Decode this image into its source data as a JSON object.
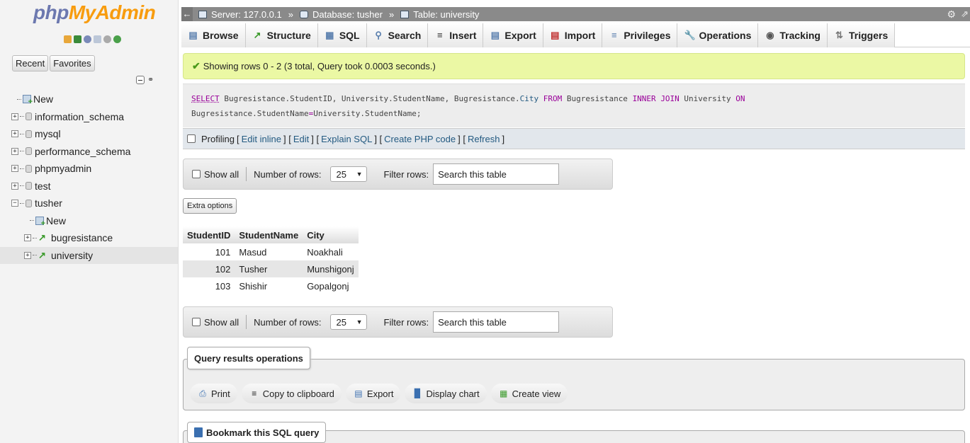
{
  "sidebar": {
    "logo_part1": "php",
    "logo_part2": "MyAdmin",
    "tabs": [
      "Recent",
      "Favorites"
    ],
    "tree": [
      {
        "label": "New",
        "type": "new",
        "level": 0
      },
      {
        "label": "information_schema",
        "type": "db",
        "level": 0
      },
      {
        "label": "mysql",
        "type": "db",
        "level": 0
      },
      {
        "label": "performance_schema",
        "type": "db",
        "level": 0
      },
      {
        "label": "phpmyadmin",
        "type": "db",
        "level": 0
      },
      {
        "label": "test",
        "type": "db",
        "level": 0
      },
      {
        "label": "tusher",
        "type": "db-open",
        "level": 0
      },
      {
        "label": "New",
        "type": "new",
        "level": 1
      },
      {
        "label": "bugresistance",
        "type": "table",
        "level": 1
      },
      {
        "label": "university",
        "type": "table",
        "level": 1
      }
    ]
  },
  "breadcrumb": {
    "server": "Server: 127.0.0.1",
    "database": "Database: tusher",
    "table": "Table: university"
  },
  "tabs": [
    "Browse",
    "Structure",
    "SQL",
    "Search",
    "Insert",
    "Export",
    "Import",
    "Privileges",
    "Operations",
    "Tracking",
    "Triggers"
  ],
  "success_message": "Showing rows 0 - 2 (3 total, Query took 0.0003 seconds.)",
  "sql": {
    "line1": {
      "select": "SELECT",
      "p1": " Bugresistance.StudentID, University.StudentName, Bugresistance.",
      "city": "City",
      "from": "FROM",
      "p2": " Bugresistance ",
      "inner": "INNER",
      "join": "JOIN",
      "p3": " University ",
      "on": "ON"
    },
    "line2": {
      "p1": "Bugresistance.StudentName",
      "eq": "=",
      "p2": "University.StudentName;"
    }
  },
  "profiling": {
    "label": "Profiling",
    "links": [
      "Edit inline",
      "Edit",
      "Explain SQL",
      "Create PHP code",
      "Refresh"
    ]
  },
  "navbar": {
    "show_all": "Show all",
    "number_of_rows": "Number of rows:",
    "rows_value": "25",
    "filter_rows": "Filter rows:",
    "search_placeholder": "Search this table"
  },
  "extra_options": "Extra options",
  "table": {
    "headers": [
      "StudentID",
      "StudentName",
      "City"
    ],
    "rows": [
      [
        "101",
        "Masud",
        "Noakhali"
      ],
      [
        "102",
        "Tusher",
        "Munshigonj"
      ],
      [
        "103",
        "Shishir",
        "Gopalgonj"
      ]
    ]
  },
  "query_results_operations": {
    "title": "Query results operations",
    "actions": [
      "Print",
      "Copy to clipboard",
      "Export",
      "Display chart",
      "Create view"
    ]
  },
  "bookmark": {
    "title": "Bookmark this SQL query"
  }
}
